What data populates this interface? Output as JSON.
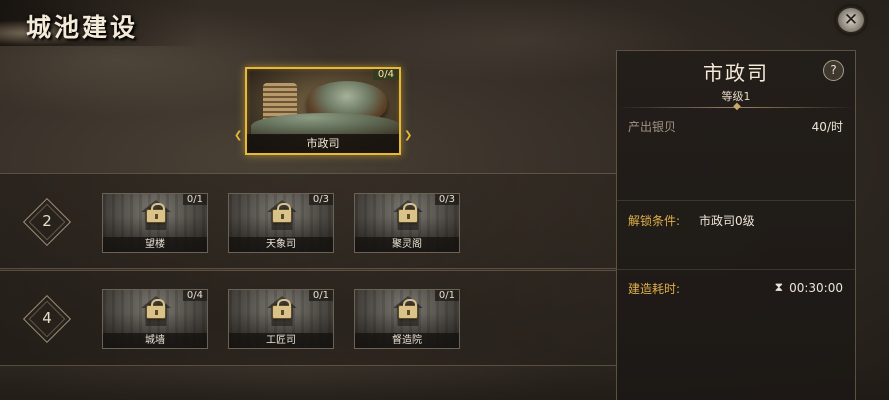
{
  "header": {
    "title": "城池建设"
  },
  "close_icon_glyph": "✕",
  "featured": {
    "name": "市政司",
    "count": "0/4"
  },
  "tiers": [
    {
      "level": "2",
      "buildings": [
        {
          "name": "望楼",
          "count": "0/1"
        },
        {
          "name": "天象司",
          "count": "0/3"
        },
        {
          "name": "聚灵阁",
          "count": "0/3"
        }
      ]
    },
    {
      "level": "4",
      "buildings": [
        {
          "name": "城墙",
          "count": "0/4"
        },
        {
          "name": "工匠司",
          "count": "0/1"
        },
        {
          "name": "督造院",
          "count": "0/1"
        }
      ]
    }
  ],
  "panel": {
    "title": "市政司",
    "level": "等级1",
    "help": "?",
    "produce_label": "产出银贝",
    "produce_value": "40/时",
    "unlock_label": "解锁条件:",
    "unlock_value": "市政司0级",
    "build_label": "建造耗时:",
    "build_time": "00:30:00"
  },
  "colors": {
    "accent_gold": "#e8b838",
    "label_orange": "#e0b04a"
  },
  "icons": [
    "close-icon",
    "lock-icon",
    "hourglass-icon",
    "help-icon"
  ]
}
